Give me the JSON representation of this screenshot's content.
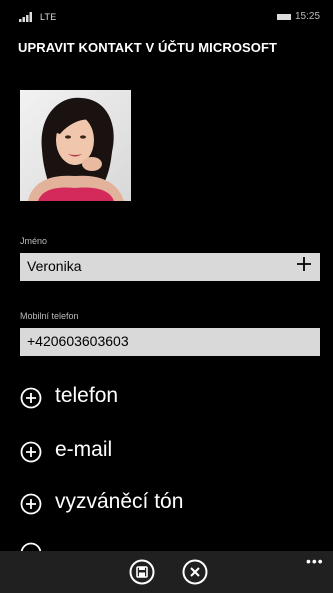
{
  "status_bar": {
    "network": "LTE",
    "time": "15:25",
    "icons": [
      "signal-icon",
      "battery-icon"
    ]
  },
  "page": {
    "title": "UPRAVIT KONTAKT V ÚČTU MICROSOFT"
  },
  "contact": {
    "name_label": "Jméno",
    "name_value": "Veronika",
    "phone_label": "Mobilní telefon",
    "phone_value": "+420603603603"
  },
  "add_items": [
    {
      "label": "telefon",
      "icon": "plus-circle-icon"
    },
    {
      "label": "e-mail",
      "icon": "plus-circle-icon"
    },
    {
      "label": "vyzváněcí tón",
      "icon": "plus-circle-icon"
    }
  ],
  "app_bar": {
    "more": "•••",
    "buttons": [
      "save-icon",
      "cancel-icon"
    ]
  },
  "colors": {
    "background": "#000000",
    "field_bg": "#d9d9d9",
    "app_bar_bg": "#202020",
    "label": "#bcbcbc"
  }
}
